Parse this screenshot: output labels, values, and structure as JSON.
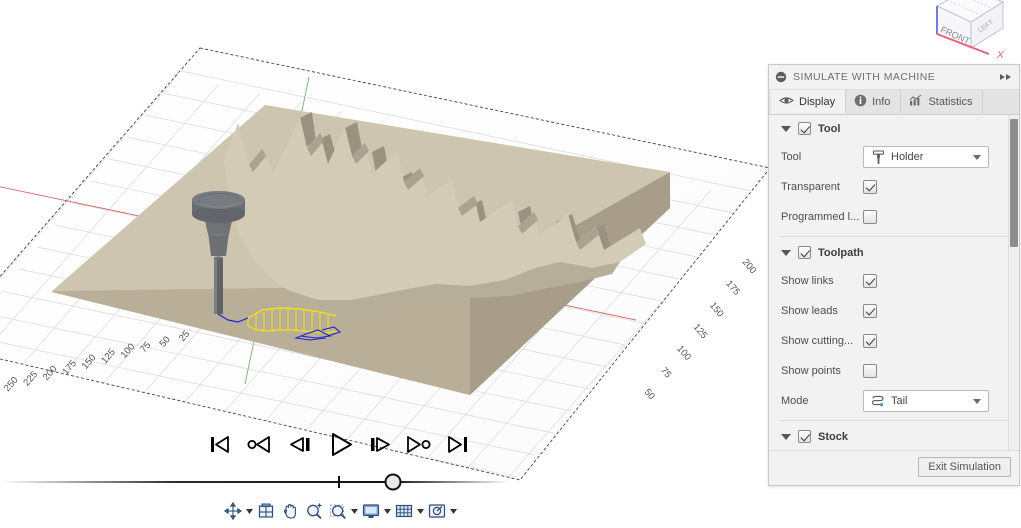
{
  "app": {
    "viewport_background": "#ffffff",
    "stock_color": "#c9c0ac",
    "stock_top_color": "#d6cebb",
    "tool_color": "#6d7174",
    "toolpath_cut_color": "#f2e11a",
    "toolpath_rapid_color": "#2222cc",
    "accent_color": "#4f8fd0"
  },
  "viewcube": {
    "face_label": "FRONT",
    "side_label": "LEFT",
    "axis_x_label": "X",
    "axis_x_color": "#e8607a",
    "axis_z_color": "#6f7fd8"
  },
  "grid": {
    "ruler_labels_left": [
      "250",
      "225",
      "200",
      "175",
      "150",
      "125",
      "100",
      "75",
      "50",
      "25"
    ],
    "ruler_labels_right": [
      "200",
      "175",
      "150",
      "125",
      "100",
      "75",
      "50"
    ],
    "ruler_labels_bottom_right": [
      "200",
      "175",
      "150",
      "125",
      "100",
      "75",
      "50"
    ],
    "axis_x_color": "#d06a6a",
    "axis_y_color": "#5aa95a"
  },
  "playback": {
    "buttons": [
      {
        "name": "skip-to-start-button",
        "title": "Skip to start"
      },
      {
        "name": "step-back-operation-button",
        "title": "Step backward one operation"
      },
      {
        "name": "step-backward-button",
        "title": "Step backward"
      },
      {
        "name": "play-button",
        "title": "Play"
      },
      {
        "name": "step-forward-button",
        "title": "Step forward"
      },
      {
        "name": "step-forward-operation-button",
        "title": "Step forward one operation"
      },
      {
        "name": "skip-to-end-button",
        "title": "Skip to end"
      }
    ],
    "slider": {
      "value_percent": 77,
      "marker_percent": 66
    }
  },
  "navbar": {
    "items": [
      {
        "name": "orbit-button",
        "icon": "orbit-icon",
        "has_caret": true
      },
      {
        "name": "look-at-button",
        "icon": "look-at-icon",
        "has_caret": false
      },
      {
        "name": "pan-button",
        "icon": "pan-hand-icon",
        "has_caret": false
      },
      {
        "name": "zoom-button",
        "icon": "zoom-plus-icon",
        "has_caret": false
      },
      {
        "name": "zoom-window-button",
        "icon": "zoom-window-icon",
        "has_caret": true
      },
      {
        "name": "display-settings-button",
        "icon": "monitor-icon",
        "has_caret": true
      },
      {
        "name": "grid-snaps-button",
        "icon": "grid-icon",
        "has_caret": true
      },
      {
        "name": "viewports-button",
        "icon": "viewports-icon",
        "has_caret": true
      }
    ]
  },
  "panel": {
    "header": {
      "title": "SIMULATE WITH MACHINE",
      "collapse_icon": "minus-circle-icon",
      "expand_icon": "double-chevron-right-icon"
    },
    "tabs": [
      {
        "label": "Display",
        "icon": "eye-icon",
        "active": true
      },
      {
        "label": "Info",
        "icon": "info-circle-icon",
        "active": false
      },
      {
        "label": "Statistics",
        "icon": "bar-chart-icon",
        "active": false
      }
    ],
    "sections": [
      {
        "name": "tool",
        "title": "Tool",
        "enabled": true,
        "expanded": true,
        "rows": [
          {
            "type": "combo",
            "label": "Tool",
            "value": "Holder",
            "icon": "tool-holder-icon",
            "name": "tool-select"
          },
          {
            "type": "check",
            "label": "Transparent",
            "checked": true,
            "name": "transparent-checkbox"
          },
          {
            "type": "check",
            "label": "Programmed l...",
            "checked": false,
            "name": "programmed-length-checkbox"
          }
        ]
      },
      {
        "name": "toolpath",
        "title": "Toolpath",
        "enabled": true,
        "expanded": true,
        "rows": [
          {
            "type": "check",
            "label": "Show links",
            "checked": true,
            "name": "show-links-checkbox"
          },
          {
            "type": "check",
            "label": "Show leads",
            "checked": true,
            "name": "show-leads-checkbox"
          },
          {
            "type": "check",
            "label": "Show cutting...",
            "checked": true,
            "name": "show-cutting-moves-checkbox"
          },
          {
            "type": "check",
            "label": "Show points",
            "checked": false,
            "name": "show-points-checkbox"
          },
          {
            "type": "combo",
            "label": "Mode",
            "value": "Tail",
            "icon": "toolpath-tail-icon",
            "name": "mode-select"
          }
        ]
      },
      {
        "name": "stock",
        "title": "Stock",
        "enabled": true,
        "expanded": true,
        "rows": []
      }
    ],
    "footer": {
      "exit_label": "Exit Simulation"
    }
  }
}
